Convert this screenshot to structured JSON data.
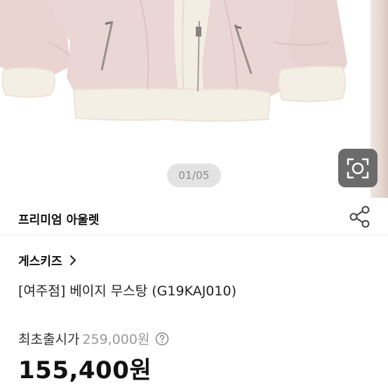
{
  "gallery": {
    "page_indicator": "01/05",
    "image_icon": "jacket-photo",
    "lens_icon": "camera-lens-icon"
  },
  "store": {
    "name": "프리미엄 아울렛",
    "share_icon": "share-icon"
  },
  "product": {
    "brand": "게스키즈",
    "brand_chevron_icon": "chevron-right-icon",
    "title": "[여주점] 베이지 무스탕 (G19KAJ010)",
    "original_price_label": "최초출시가",
    "original_price": "259,000원",
    "info_icon": "question-circle-icon",
    "sale_price": "155,400원"
  },
  "colors": {
    "jacket_suede": "#e8d3d1",
    "shearling": "#f3eee4",
    "indicator_bg": "#e3e3e3",
    "lens_button_bg": "#6b6b6b"
  }
}
